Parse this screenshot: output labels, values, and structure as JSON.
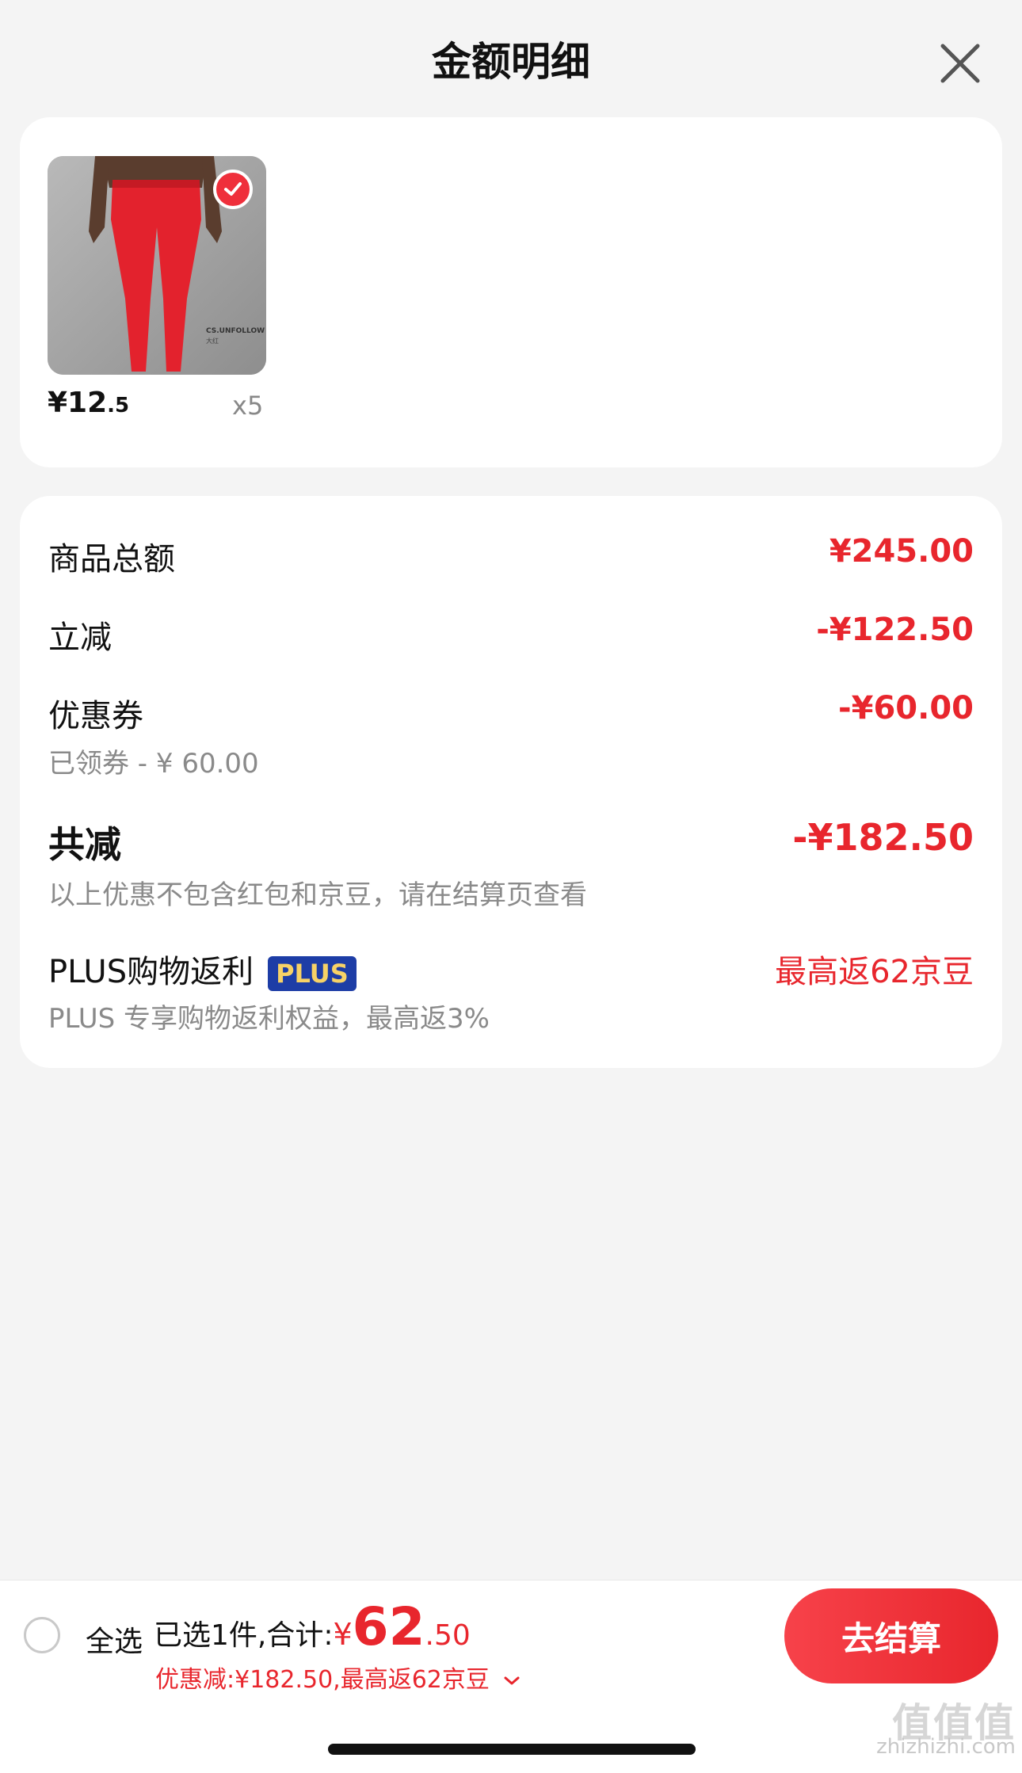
{
  "header": {
    "title": "金额明细"
  },
  "product": {
    "price_main": "¥12",
    "price_decimal": ".5",
    "quantity": "x5",
    "image_text_1": "CS.UNFOLLOW",
    "image_text_2": "大红"
  },
  "details": {
    "goods_total_label": "商品总额",
    "goods_total_value": "¥245.00",
    "instant_off_label": "立减",
    "instant_off_value": "-¥122.50",
    "coupon_label": "优惠券",
    "coupon_value": "-¥60.00",
    "coupon_sub": "已领券 - ¥ 60.00",
    "total_off_label": "共减",
    "total_off_value": "-¥182.50",
    "total_off_sub": "以上优惠不包含红包和京豆，请在结算页查看",
    "plus_label": "PLUS购物返利",
    "plus_badge": "PLUS",
    "plus_value": "最高返62京豆",
    "plus_sub": "PLUS 专享购物返利权益，最高返3%"
  },
  "footer": {
    "select_all": "全选",
    "selected_text": "已选1件,合计:",
    "total_symbol": "¥",
    "total_int": "62",
    "total_decimal": ".50",
    "discount_text": "优惠减:¥182.50,最高返62京豆",
    "checkout_label": "去结算"
  },
  "watermark": {
    "line1": "值值值",
    "line2": "zhizhizhi.com"
  },
  "colors": {
    "accent_red": "#e8262d",
    "plus_blue": "#1d3da6",
    "plus_gold": "#f7d266"
  }
}
